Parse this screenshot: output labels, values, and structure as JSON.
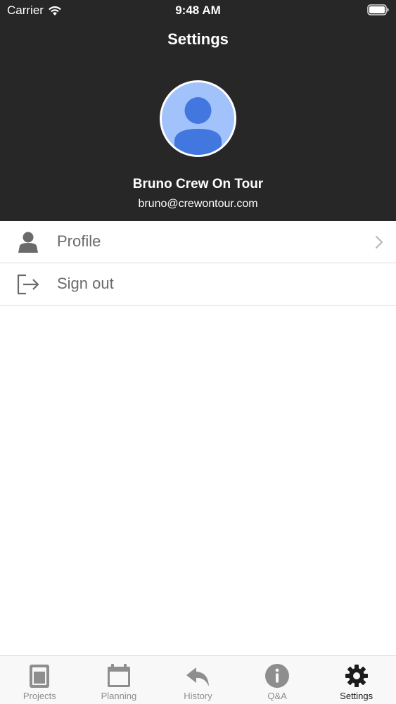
{
  "status_bar": {
    "carrier": "Carrier",
    "time": "9:48 AM"
  },
  "nav": {
    "title": "Settings"
  },
  "user": {
    "name": "Bruno Crew On Tour",
    "email": "bruno@crewontour.com"
  },
  "menu": {
    "items": [
      {
        "label": "Profile",
        "icon": "person-icon",
        "has_chevron": true
      },
      {
        "label": "Sign out",
        "icon": "sign-out-icon",
        "has_chevron": false
      }
    ]
  },
  "tabbar": {
    "active": "Settings",
    "tabs": [
      {
        "label": "Projects",
        "icon": "projects-icon"
      },
      {
        "label": "Planning",
        "icon": "calendar-icon"
      },
      {
        "label": "History",
        "icon": "history-back-arrow-icon"
      },
      {
        "label": "Q&A",
        "icon": "info-icon"
      },
      {
        "label": "Settings",
        "icon": "gear-icon"
      }
    ]
  },
  "colors": {
    "header_bg": "#272727",
    "avatar_bg": "#a1c2fa",
    "avatar_figure": "#4277e0",
    "menu_text": "#6a6a6a",
    "tab_inactive": "#8e8e8e",
    "tab_active": "#1c1c1c"
  }
}
